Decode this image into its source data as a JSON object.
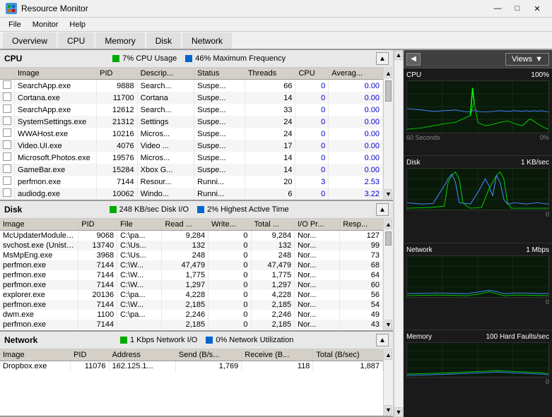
{
  "titlebar": {
    "title": "Resource Monitor",
    "icon": "📊",
    "minimize": "—",
    "maximize": "□",
    "close": "✕"
  },
  "menubar": {
    "items": [
      "File",
      "Monitor",
      "Help"
    ]
  },
  "tabs": {
    "items": [
      "Overview",
      "CPU",
      "Memory",
      "Disk",
      "Network"
    ],
    "active": "Overview"
  },
  "cpu_section": {
    "title": "CPU",
    "stat1_color": "green",
    "stat1_text": "7% CPU Usage",
    "stat2_color": "blue",
    "stat2_text": "46% Maximum Frequency",
    "columns": [
      "Image",
      "PID",
      "Descrip...",
      "Status",
      "Threads",
      "CPU",
      "Averag..."
    ],
    "rows": [
      [
        "SearchApp.exe",
        "9888",
        "Search...",
        "Suspe...",
        "66",
        "0",
        "0.00"
      ],
      [
        "Cortana.exe",
        "11700",
        "Cortana",
        "Suspe...",
        "14",
        "0",
        "0.00"
      ],
      [
        "SearchApp.exe",
        "12612",
        "Search...",
        "Suspe...",
        "33",
        "0",
        "0.00"
      ],
      [
        "SystemSettings.exe",
        "21312",
        "Settings",
        "Suspe...",
        "24",
        "0",
        "0.00"
      ],
      [
        "WWAHost.exe",
        "10216",
        "Micros...",
        "Suspe...",
        "24",
        "0",
        "0.00"
      ],
      [
        "Video.UI.exe",
        "4076",
        "Video ...",
        "Suspe...",
        "17",
        "0",
        "0.00"
      ],
      [
        "Microsoft.Photos.exe",
        "19576",
        "Micros...",
        "Suspe...",
        "14",
        "0",
        "0.00"
      ],
      [
        "GameBar.exe",
        "15284",
        "Xbox G...",
        "Suspe...",
        "14",
        "0",
        "0.00"
      ],
      [
        "perfmon.exe",
        "7144",
        "Resour...",
        "Runni...",
        "20",
        "3",
        "2.53"
      ],
      [
        "audiodg.exe",
        "10062",
        "Windo...",
        "Runni...",
        "6",
        "0",
        "3.22"
      ]
    ]
  },
  "disk_section": {
    "title": "Disk",
    "stat1_color": "green",
    "stat1_text": "248 KB/sec Disk I/O",
    "stat2_color": "blue",
    "stat2_text": "2% Highest Active Time",
    "columns": [
      "Image",
      "PID",
      "File",
      "Read ...",
      "Write...",
      "Total ...",
      "I/O Pr...",
      "Resp..."
    ],
    "rows": [
      [
        "McUpdaterModule.exe",
        "9068",
        "C:\\pa...",
        "9,284",
        "0",
        "9,284",
        "Nor...",
        "127"
      ],
      [
        "svchost.exe (UnistackSvcGroup)",
        "13740",
        "C:\\Us...",
        "132",
        "0",
        "132",
        "Nor...",
        "99"
      ],
      [
        "MsMpEng.exe",
        "3968",
        "C:\\Us...",
        "248",
        "0",
        "248",
        "Nor...",
        "73"
      ],
      [
        "perfmon.exe",
        "7144",
        "C:\\W...",
        "47,479",
        "0",
        "47,479",
        "Nor...",
        "68"
      ],
      [
        "perfmon.exe",
        "7144",
        "C:\\W...",
        "1,775",
        "0",
        "1,775",
        "Nor...",
        "64"
      ],
      [
        "perfmon.exe",
        "7144",
        "C:\\W...",
        "1,297",
        "0",
        "1,297",
        "Nor...",
        "60"
      ],
      [
        "explorer.exe",
        "20136",
        "C:\\pa...",
        "4,228",
        "0",
        "4,228",
        "Nor...",
        "56"
      ],
      [
        "perfmon.exe",
        "7144",
        "C:\\W...",
        "2,185",
        "0",
        "2,185",
        "Nor...",
        "54"
      ],
      [
        "dwm.exe",
        "1100",
        "C:\\pa...",
        "2,246",
        "0",
        "2,246",
        "Nor...",
        "49"
      ],
      [
        "perfmon.exe",
        "7144",
        "",
        "2,185",
        "0",
        "2,185",
        "Nor...",
        "43"
      ]
    ]
  },
  "network_section": {
    "title": "Network",
    "stat1_color": "green",
    "stat1_text": "1 Kbps Network I/O",
    "stat2_color": "blue",
    "stat2_text": "0% Network Utilization",
    "columns": [
      "Image",
      "PID",
      "Address",
      "Send (B/s...",
      "Receive (B...",
      "Total (B/sec)"
    ],
    "rows": [
      [
        "Dropbox.exe",
        "11076",
        "162.125.1...",
        "1,769",
        "118",
        "1,887"
      ]
    ]
  },
  "right_panel": {
    "expand_icon": "◀",
    "views_label": "Views",
    "views_dropdown": "▼",
    "cpu_graph": {
      "label": "CPU",
      "max": "100%",
      "min": "0%",
      "time_label": "60 Seconds"
    },
    "disk_graph": {
      "label": "Disk",
      "value": "1 KB/sec",
      "min": "0"
    },
    "network_graph": {
      "label": "Network",
      "value": "1 Mbps",
      "min": "0"
    },
    "memory_graph": {
      "label": "Memory",
      "value": "100 Hard Faults/sec",
      "min": "0"
    }
  }
}
